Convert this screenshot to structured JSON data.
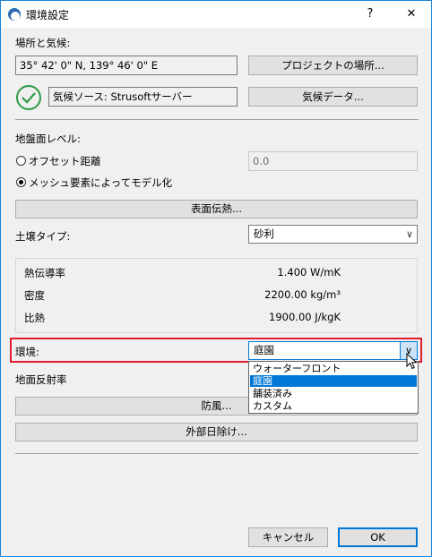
{
  "window": {
    "title": "環境設定",
    "help_label": "?",
    "close_label": "✕"
  },
  "location": {
    "section_label": "場所と気候:",
    "coordinates": "35° 42' 0\" N, 139° 46' 0\" E",
    "project_location_button": "プロジェクトの場所...",
    "climate_source": "気候ソース: Strusoftサーバー",
    "climate_data_button": "気候データ..."
  },
  "ground": {
    "section_label": "地盤面レベル:",
    "offset_option": "オフセット距離",
    "offset_value": "0.0",
    "mesh_option": "メッシュ要素によってモデル化",
    "surface_heat_button": "表面伝熱..."
  },
  "soil": {
    "label": "土壌タイプ:",
    "selected": "砂利",
    "properties": [
      {
        "name": "熱伝導率",
        "value": "1.400 W/mK"
      },
      {
        "name": "密度",
        "value": "2200.00 kg/m³"
      },
      {
        "name": "比熱",
        "value": "1900.00 J/kgK"
      }
    ]
  },
  "surroundings": {
    "label": "環境:",
    "selected": "庭園",
    "options": [
      "ウォーターフロント",
      "庭園",
      "舗装済み",
      "カスタム"
    ],
    "selected_index": 1
  },
  "albedo_label": "地面反射率",
  "wind_button": "防風...",
  "shading_button": "外部日除け...",
  "footer": {
    "cancel": "キャンセル",
    "ok": "OK"
  },
  "colors": {
    "highlight_frame": "#e21c2c",
    "check_green": "#2e9b45",
    "selection_blue": "#0078d7"
  }
}
